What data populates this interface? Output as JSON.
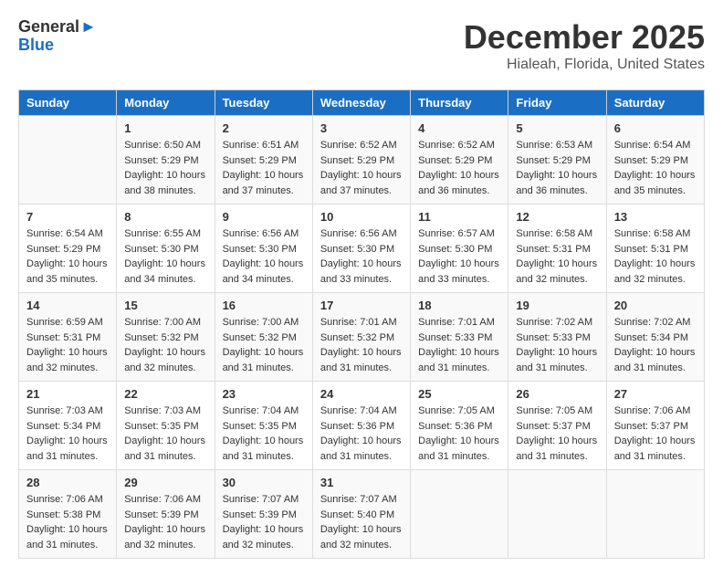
{
  "logo": {
    "general": "General",
    "blue": "Blue",
    "arrow": "▶"
  },
  "header": {
    "title": "December 2025",
    "subtitle": "Hialeah, Florida, United States"
  },
  "weekdays": [
    "Sunday",
    "Monday",
    "Tuesday",
    "Wednesday",
    "Thursday",
    "Friday",
    "Saturday"
  ],
  "weeks": [
    [
      {
        "day": "",
        "info": ""
      },
      {
        "day": "1",
        "info": "Sunrise: 6:50 AM\nSunset: 5:29 PM\nDaylight: 10 hours\nand 38 minutes."
      },
      {
        "day": "2",
        "info": "Sunrise: 6:51 AM\nSunset: 5:29 PM\nDaylight: 10 hours\nand 37 minutes."
      },
      {
        "day": "3",
        "info": "Sunrise: 6:52 AM\nSunset: 5:29 PM\nDaylight: 10 hours\nand 37 minutes."
      },
      {
        "day": "4",
        "info": "Sunrise: 6:52 AM\nSunset: 5:29 PM\nDaylight: 10 hours\nand 36 minutes."
      },
      {
        "day": "5",
        "info": "Sunrise: 6:53 AM\nSunset: 5:29 PM\nDaylight: 10 hours\nand 36 minutes."
      },
      {
        "day": "6",
        "info": "Sunrise: 6:54 AM\nSunset: 5:29 PM\nDaylight: 10 hours\nand 35 minutes."
      }
    ],
    [
      {
        "day": "7",
        "info": "Sunrise: 6:54 AM\nSunset: 5:29 PM\nDaylight: 10 hours\nand 35 minutes."
      },
      {
        "day": "8",
        "info": "Sunrise: 6:55 AM\nSunset: 5:30 PM\nDaylight: 10 hours\nand 34 minutes."
      },
      {
        "day": "9",
        "info": "Sunrise: 6:56 AM\nSunset: 5:30 PM\nDaylight: 10 hours\nand 34 minutes."
      },
      {
        "day": "10",
        "info": "Sunrise: 6:56 AM\nSunset: 5:30 PM\nDaylight: 10 hours\nand 33 minutes."
      },
      {
        "day": "11",
        "info": "Sunrise: 6:57 AM\nSunset: 5:30 PM\nDaylight: 10 hours\nand 33 minutes."
      },
      {
        "day": "12",
        "info": "Sunrise: 6:58 AM\nSunset: 5:31 PM\nDaylight: 10 hours\nand 32 minutes."
      },
      {
        "day": "13",
        "info": "Sunrise: 6:58 AM\nSunset: 5:31 PM\nDaylight: 10 hours\nand 32 minutes."
      }
    ],
    [
      {
        "day": "14",
        "info": "Sunrise: 6:59 AM\nSunset: 5:31 PM\nDaylight: 10 hours\nand 32 minutes."
      },
      {
        "day": "15",
        "info": "Sunrise: 7:00 AM\nSunset: 5:32 PM\nDaylight: 10 hours\nand 32 minutes."
      },
      {
        "day": "16",
        "info": "Sunrise: 7:00 AM\nSunset: 5:32 PM\nDaylight: 10 hours\nand 31 minutes."
      },
      {
        "day": "17",
        "info": "Sunrise: 7:01 AM\nSunset: 5:32 PM\nDaylight: 10 hours\nand 31 minutes."
      },
      {
        "day": "18",
        "info": "Sunrise: 7:01 AM\nSunset: 5:33 PM\nDaylight: 10 hours\nand 31 minutes."
      },
      {
        "day": "19",
        "info": "Sunrise: 7:02 AM\nSunset: 5:33 PM\nDaylight: 10 hours\nand 31 minutes."
      },
      {
        "day": "20",
        "info": "Sunrise: 7:02 AM\nSunset: 5:34 PM\nDaylight: 10 hours\nand 31 minutes."
      }
    ],
    [
      {
        "day": "21",
        "info": "Sunrise: 7:03 AM\nSunset: 5:34 PM\nDaylight: 10 hours\nand 31 minutes."
      },
      {
        "day": "22",
        "info": "Sunrise: 7:03 AM\nSunset: 5:35 PM\nDaylight: 10 hours\nand 31 minutes."
      },
      {
        "day": "23",
        "info": "Sunrise: 7:04 AM\nSunset: 5:35 PM\nDaylight: 10 hours\nand 31 minutes."
      },
      {
        "day": "24",
        "info": "Sunrise: 7:04 AM\nSunset: 5:36 PM\nDaylight: 10 hours\nand 31 minutes."
      },
      {
        "day": "25",
        "info": "Sunrise: 7:05 AM\nSunset: 5:36 PM\nDaylight: 10 hours\nand 31 minutes."
      },
      {
        "day": "26",
        "info": "Sunrise: 7:05 AM\nSunset: 5:37 PM\nDaylight: 10 hours\nand 31 minutes."
      },
      {
        "day": "27",
        "info": "Sunrise: 7:06 AM\nSunset: 5:37 PM\nDaylight: 10 hours\nand 31 minutes."
      }
    ],
    [
      {
        "day": "28",
        "info": "Sunrise: 7:06 AM\nSunset: 5:38 PM\nDaylight: 10 hours\nand 31 minutes."
      },
      {
        "day": "29",
        "info": "Sunrise: 7:06 AM\nSunset: 5:39 PM\nDaylight: 10 hours\nand 32 minutes."
      },
      {
        "day": "30",
        "info": "Sunrise: 7:07 AM\nSunset: 5:39 PM\nDaylight: 10 hours\nand 32 minutes."
      },
      {
        "day": "31",
        "info": "Sunrise: 7:07 AM\nSunset: 5:40 PM\nDaylight: 10 hours\nand 32 minutes."
      },
      {
        "day": "",
        "info": ""
      },
      {
        "day": "",
        "info": ""
      },
      {
        "day": "",
        "info": ""
      }
    ]
  ]
}
